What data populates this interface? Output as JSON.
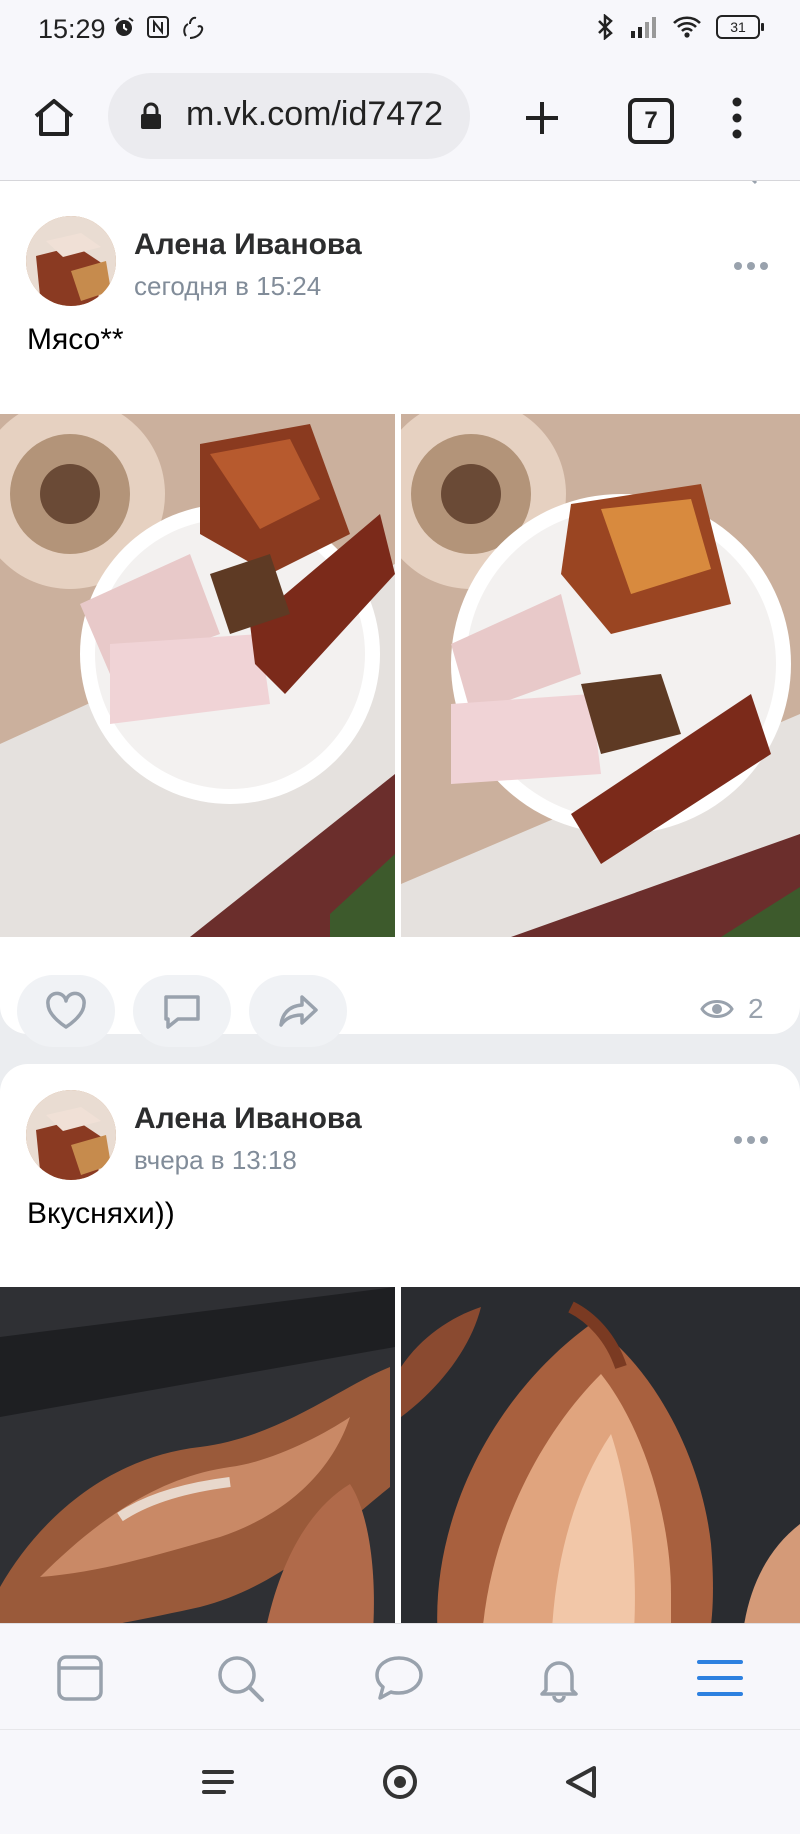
{
  "status_bar": {
    "time": "15:29",
    "battery": "31",
    "icons": [
      "alarm-icon",
      "nfc-icon",
      "gesture-icon",
      "bluetooth-icon",
      "signal-icon",
      "wifi-icon"
    ]
  },
  "browser": {
    "url": "m.vk.com/id7472",
    "tab_count": "7",
    "icons": [
      "home-icon",
      "lock-icon",
      "new-tab-plus-icon",
      "overflow-menu-icon"
    ]
  },
  "posts": [
    {
      "author": "Алена Иванова",
      "time": "сегодня в 15:24",
      "text": "Мясо**",
      "views": "2",
      "photos": [
        "smoked-meat-plate-photo-1",
        "smoked-meat-plate-photo-2"
      ]
    },
    {
      "author": "Алена Иванова",
      "time": "вчера в 13:18",
      "text": "Вкусняхи))",
      "photos": [
        "smoked-fish-photo-1",
        "smoked-fish-photo-2"
      ]
    }
  ],
  "tabbar": {
    "items": [
      "news-feed-icon",
      "search-icon",
      "messages-icon",
      "notifications-icon",
      "menu-icon"
    ],
    "active": "menu-icon",
    "accent": "#2d81e0"
  },
  "colors": {
    "background": "#ebedf0",
    "card": "#ffffff",
    "secondary_text": "#818c99",
    "icon_gray": "#99a2ad"
  }
}
